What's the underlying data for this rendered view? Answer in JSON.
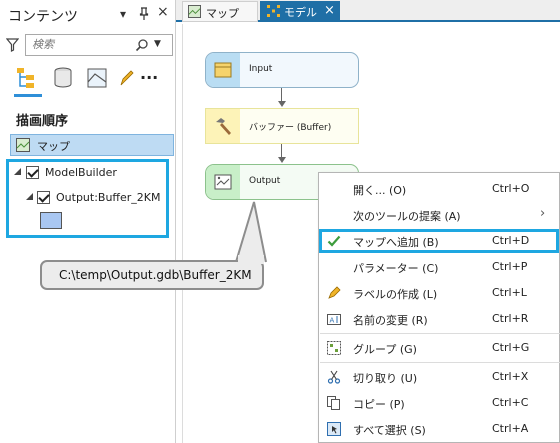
{
  "contents_pane": {
    "title": "コンテンツ",
    "header_buttons": {
      "menu": "▾",
      "pin": "ꟸ",
      "close": "×"
    },
    "search": {
      "placeholder": "検索"
    },
    "section_label": "描画順序",
    "map_item": {
      "label": "マップ",
      "icon": "map-icon"
    },
    "tree": [
      {
        "label": "ModelBuilder",
        "checked": true
      },
      {
        "label": "Output:Buffer_2KM",
        "checked": true
      }
    ],
    "symbol_color": "#a9c7f2",
    "more_label": "···"
  },
  "tabs": [
    {
      "label": "マップ",
      "icon": "map-icon"
    },
    {
      "label": "モデル",
      "icon": "model-icon",
      "close": "×",
      "active": true
    }
  ],
  "model": {
    "nodes": [
      {
        "label": "Input",
        "icon": "dataset-icon"
      },
      {
        "label": "バッファー (Buffer)",
        "icon": "hammer-icon"
      },
      {
        "label": "Output",
        "icon": "feature-class-icon"
      }
    ]
  },
  "callout": {
    "text": "C:\\temp\\Output.gdb\\Buffer_2KM"
  },
  "context_menu": {
    "items": [
      {
        "label": "開く... (O)",
        "shortcut": "Ctrl+O",
        "icon": ""
      },
      {
        "label": "次のツールの提案 (A)",
        "shortcut": "",
        "icon": "",
        "submenu": "›"
      },
      {
        "label": "マップへ追加 (B)",
        "shortcut": "Ctrl+D",
        "icon": "check-icon"
      },
      {
        "label": "パラメーター (C)",
        "shortcut": "Ctrl+P",
        "icon": ""
      },
      {
        "label": "ラベルの作成 (L)",
        "shortcut": "Ctrl+L",
        "icon": "label-icon"
      },
      {
        "label": "名前の変更 (R)",
        "shortcut": "Ctrl+R",
        "icon": "rename-icon"
      },
      {
        "label": "グループ (G)",
        "shortcut": "Ctrl+G",
        "icon": "group-icon"
      },
      {
        "label": "切り取り (U)",
        "shortcut": "Ctrl+X",
        "icon": "cut-icon"
      },
      {
        "label": "コピー (P)",
        "shortcut": "Ctrl+C",
        "icon": "copy-icon"
      },
      {
        "label": "すべて選択 (S)",
        "shortcut": "Ctrl+A",
        "icon": "select-all-icon"
      }
    ]
  },
  "colors": {
    "accent_highlight": "#1ea7e1",
    "active_tab": "#1f6fa6",
    "selection": "#bedbf3"
  }
}
